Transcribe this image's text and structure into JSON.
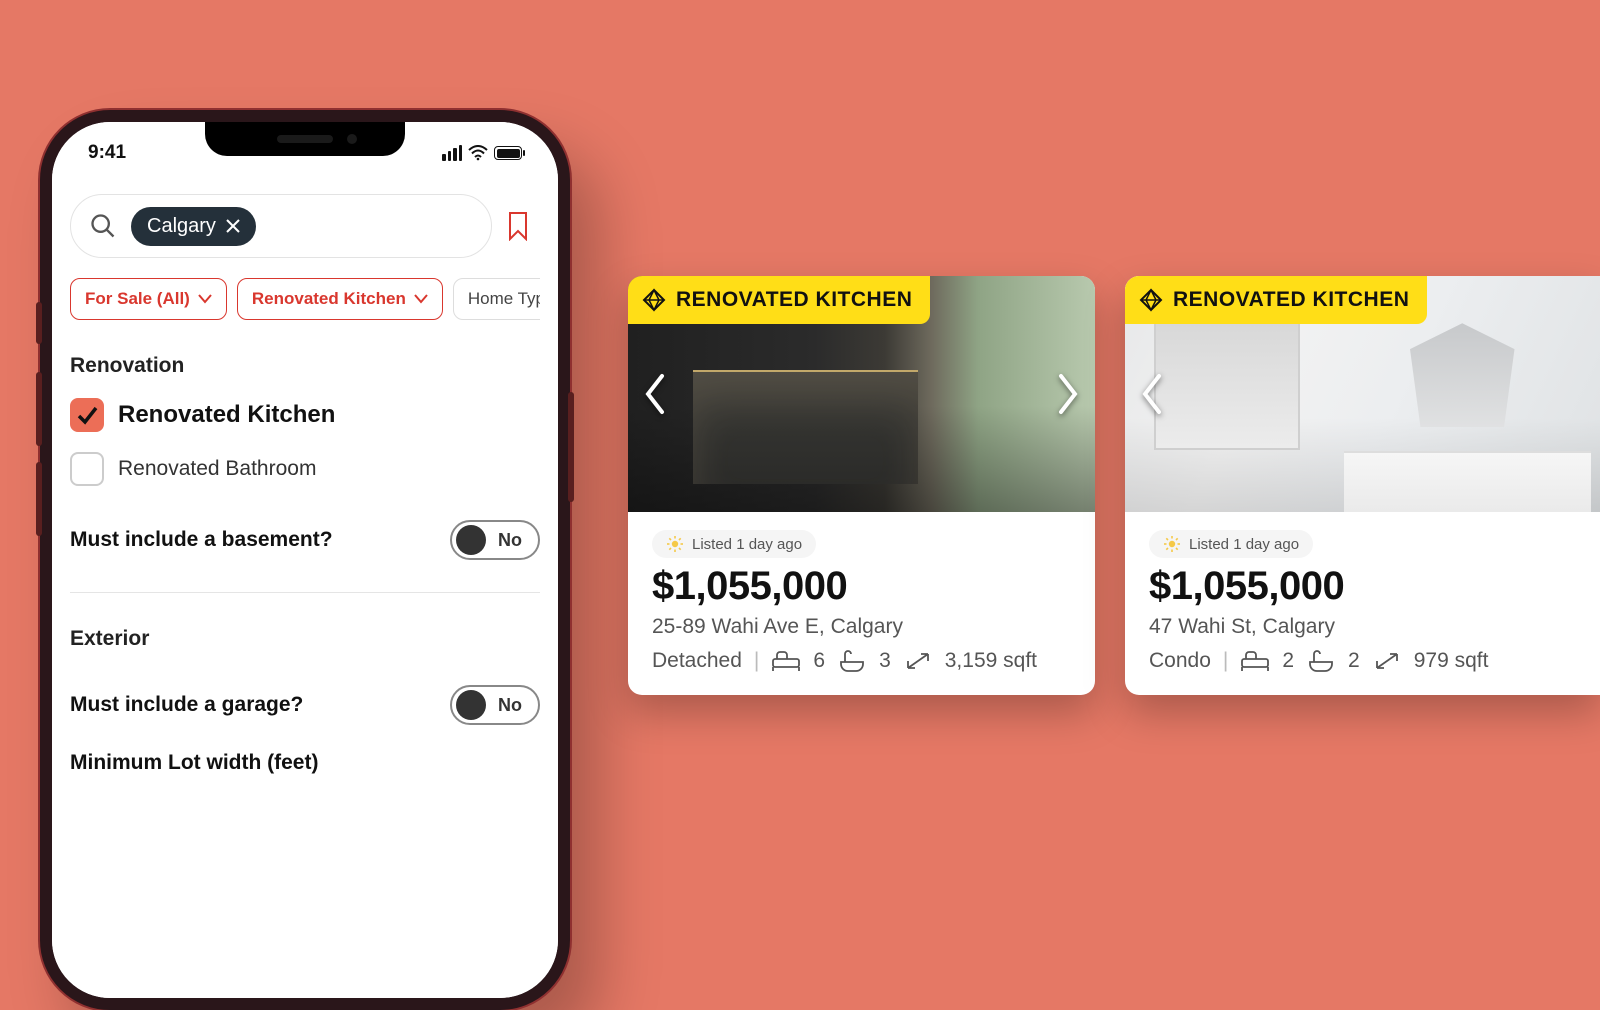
{
  "status": {
    "time": "9:41"
  },
  "search": {
    "chip": "Calgary"
  },
  "filters": {
    "for_sale": "For Sale (All)",
    "renovated_kitchen": "Renovated Kitchen",
    "home_type": "Home Type"
  },
  "section_renovation": {
    "title": "Renovation",
    "opt_kitchen": "Renovated Kitchen",
    "opt_bathroom": "Renovated Bathroom",
    "basement_q": "Must include a basement?",
    "toggle_no": "No"
  },
  "section_exterior": {
    "title": "Exterior",
    "garage_q": "Must include a garage?",
    "lot_width_q": "Minimum Lot width (feet)",
    "toggle_no": "No"
  },
  "badge_text": "RENOVATED KITCHEN",
  "listings": [
    {
      "listed": "Listed 1 day ago",
      "price": "$1,055,000",
      "address": "25-89 Wahi Ave E, Calgary",
      "type": "Detached",
      "beds": "6",
      "baths": "3",
      "area": "3,159 sqft"
    },
    {
      "listed": "Listed 1 day ago",
      "price": "$1,055,000",
      "address": "47 Wahi St, Calgary",
      "type": "Condo",
      "beds": "2",
      "baths": "2",
      "area": "979 sqft"
    }
  ]
}
